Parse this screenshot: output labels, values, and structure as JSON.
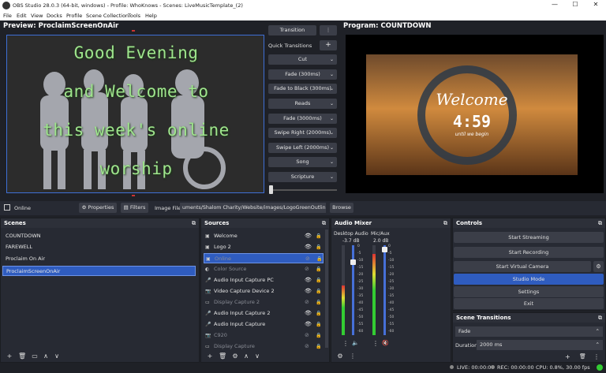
{
  "window": {
    "title": "OBS Studio 28.0.3 (64-bit, windows) - Profile: WhoKnows - Scenes: LiveMusicTemplate_(2)",
    "minimize": "—",
    "maximize": "☐",
    "close": "✕"
  },
  "menu": [
    "File",
    "Edit",
    "View",
    "Docks",
    "Profile",
    "Scene Collection",
    "Tools",
    "Help"
  ],
  "preview": {
    "label": "Preview: ProclaimScreenOnAir",
    "lines": [
      "Good Evening",
      "and Welcome to",
      "this week's online",
      "worship"
    ]
  },
  "program": {
    "label": "Program: COUNTDOWN",
    "welcome": "Welcome",
    "countdown": "4:59",
    "subtitle": "until we begin"
  },
  "transitions": {
    "transition_btn": "Transition",
    "more": "⋮",
    "quick_label": "Quick Transitions",
    "add": "+",
    "items": [
      "Cut",
      "Fade (300ms)",
      "Fade to Black (300ms)",
      "Reads",
      "Fade (3000ms)",
      "Swipe Right (2000ms)",
      "Swipe Left (2000ms)",
      "Song",
      "Scripture"
    ]
  },
  "sourcebar": {
    "source": "Online",
    "properties": "Properties",
    "filters": "Filters",
    "image_label": "Image File",
    "path": "uments/Shalom Charity/Website/images/LogoGreenOutline.png",
    "browse": "Browse"
  },
  "scenes": {
    "title": "Scenes",
    "items": [
      "COUNTDOWN",
      "FAREWELL",
      "Proclaim On Air",
      "ProclaimScreenOnAir"
    ],
    "selected": 3
  },
  "sources": {
    "title": "Sources",
    "items": [
      {
        "name": "Welcome",
        "icon": "image-icon",
        "visible": true
      },
      {
        "name": "Logo 2",
        "icon": "image-icon",
        "visible": true
      },
      {
        "name": "Online",
        "icon": "image-icon",
        "visible": false,
        "selected": true
      },
      {
        "name": "Color Source",
        "icon": "color-icon",
        "visible": false
      },
      {
        "name": "Audio Input Capture PC",
        "icon": "mic-icon",
        "visible": true
      },
      {
        "name": "Video Capture Device 2",
        "icon": "camera-icon",
        "visible": true
      },
      {
        "name": "Display Capture 2",
        "icon": "monitor-icon",
        "visible": false
      },
      {
        "name": "Audio Input Capture 2",
        "icon": "mic-icon",
        "visible": true
      },
      {
        "name": "Audio Input Capture",
        "icon": "mic-icon",
        "visible": true
      },
      {
        "name": "C920",
        "icon": "camera-icon",
        "visible": false
      },
      {
        "name": "Display Capture",
        "icon": "monitor-icon",
        "visible": false
      }
    ]
  },
  "mixer": {
    "title": "Audio Mixer",
    "channels": [
      {
        "name": "Desktop Audio",
        "db": "-3.7 dB",
        "level": 0.55
      },
      {
        "name": "Mic/Aux",
        "db": "2.0 dB",
        "level": 0.9
      }
    ],
    "scale": [
      "0",
      "-5",
      "-10",
      "-15",
      "-20",
      "-25",
      "-30",
      "-35",
      "-40",
      "-45",
      "-50",
      "-55",
      "-60"
    ]
  },
  "controls": {
    "title": "Controls",
    "start_streaming": "Start Streaming",
    "start_recording": "Start Recording",
    "start_virtual_camera": "Start Virtual Camera",
    "studio_mode": "Studio Mode",
    "settings": "Settings",
    "exit": "Exit"
  },
  "scene_transitions": {
    "title": "Scene Transitions",
    "selected": "Fade",
    "duration_label": "Duration",
    "duration": "2000 ms"
  },
  "status": {
    "live": "LIVE: 00:00:00",
    "rec": "REC: 00:00:00",
    "cpu": "CPU: 0.8%, 30.00 fps"
  },
  "colors": {
    "accent": "#3e6fd6",
    "selected_row": "#2f5cbf",
    "green_text": "#9fe58d"
  }
}
